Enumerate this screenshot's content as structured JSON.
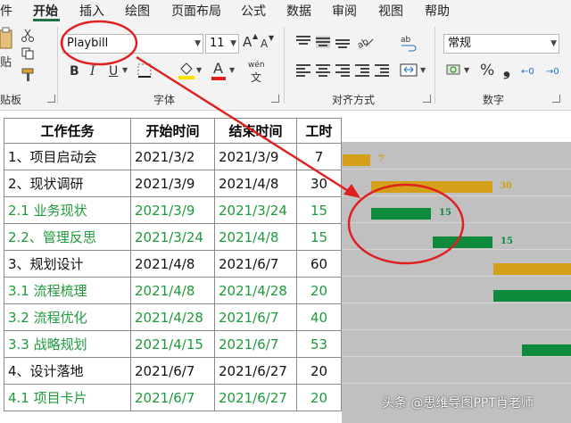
{
  "ribbon": {
    "tabs": [
      {
        "label": "件"
      },
      {
        "label": "开始"
      },
      {
        "label": "插入"
      },
      {
        "label": "绘图"
      },
      {
        "label": "页面布局"
      },
      {
        "label": "公式"
      },
      {
        "label": "数据"
      },
      {
        "label": "审阅"
      },
      {
        "label": "视图"
      },
      {
        "label": "帮助"
      }
    ],
    "active_tab": "开始",
    "clipboard": {
      "paste_label": "贴",
      "group_label": "贴板"
    },
    "font": {
      "family_value": "Playbill",
      "size_value": "11",
      "bold": "B",
      "italic": "I",
      "underline": "U",
      "grow": "A",
      "shrink": "A",
      "font_color_letter": "A",
      "phonetic": "wén",
      "group_label": "字体"
    },
    "alignment": {
      "group_label": "对齐方式"
    },
    "number": {
      "format_value": "常规",
      "currency": "⊞",
      "percent": "%",
      "comma": "❟",
      "inc_decimal": "←0",
      "dec_decimal": "→0",
      "group_label": "数字"
    }
  },
  "table": {
    "headers": [
      "工作任务",
      "开始时间",
      "结束时间",
      "工时"
    ],
    "rows": [
      {
        "task": "1、项目启动会",
        "start": "2021/3/2",
        "end": "2021/3/9",
        "hours": "7",
        "type": "main"
      },
      {
        "task": "2、现状调研",
        "start": "2021/3/9",
        "end": "2021/4/8",
        "hours": "30",
        "type": "main"
      },
      {
        "task": "2.1 业务现状",
        "start": "2021/3/9",
        "end": "2021/3/24",
        "hours": "15",
        "type": "sub"
      },
      {
        "task": "2.2、管理反思",
        "start": "2021/3/24",
        "end": "2021/4/8",
        "hours": "15",
        "type": "sub"
      },
      {
        "task": "3、规划设计",
        "start": "2021/4/8",
        "end": "2021/6/7",
        "hours": "60",
        "type": "main"
      },
      {
        "task": "3.1 流程梳理",
        "start": "2021/4/8",
        "end": "2021/4/28",
        "hours": "20",
        "type": "sub"
      },
      {
        "task": "3.2 流程优化",
        "start": "2021/4/28",
        "end": "2021/6/7",
        "hours": "40",
        "type": "sub"
      },
      {
        "task": "3.3 战略规划",
        "start": "2021/4/15",
        "end": "2021/6/7",
        "hours": "53",
        "type": "sub"
      },
      {
        "task": "4、设计落地",
        "start": "2021/6/7",
        "end": "2021/6/27",
        "hours": "20",
        "type": "main"
      },
      {
        "task": "4.1 项目卡片",
        "start": "2021/6/7",
        "end": "2021/6/27",
        "hours": "20",
        "type": "sub"
      }
    ]
  },
  "gantt": {
    "bars": [
      {
        "label": "7",
        "color": "#d4a017"
      },
      {
        "label": "30",
        "color": "#d4a017"
      },
      {
        "label": "15",
        "color": "#0e8a3c"
      },
      {
        "label": "15",
        "color": "#0e8a3c"
      },
      {
        "label": "",
        "color": "#d4a017"
      },
      {
        "label": "",
        "color": "#0e8a3c"
      },
      {
        "label": "",
        "color": "#0e8a3c"
      }
    ]
  },
  "colors": {
    "main_bar": "#d4a017",
    "sub_bar": "#0e8a3c",
    "sub_text": "#1f9a3a",
    "annotation": "#e02020",
    "accent": "#217346"
  },
  "watermark": "头条 @思维导图PPT肖老师"
}
